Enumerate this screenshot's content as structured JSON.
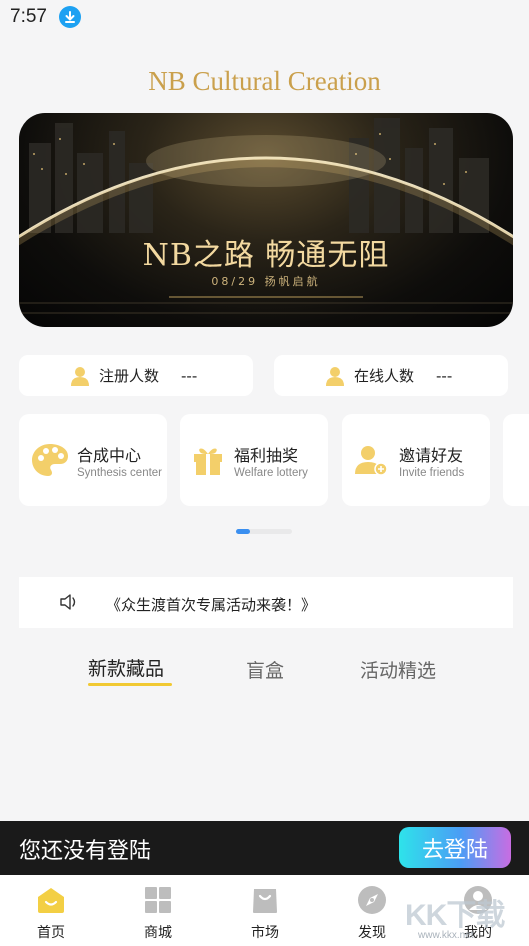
{
  "status_bar": {
    "time": "7:57",
    "download_icon": "download-icon"
  },
  "app": {
    "title": "NB Cultural Creation"
  },
  "banner": {
    "title": "NB之路  畅通无阻",
    "subtitle": "08/29   扬帆启航"
  },
  "stats": [
    {
      "label": "注册人数",
      "value": "---",
      "icon": "person-icon"
    },
    {
      "label": "在线人数",
      "value": "---",
      "icon": "person-icon"
    }
  ],
  "features": [
    {
      "title": "合成中心",
      "subtitle": "Synthesis center",
      "icon": "palette-icon"
    },
    {
      "title": "福利抽奖",
      "subtitle": "Welfare lottery",
      "icon": "gift-icon"
    },
    {
      "title": "邀请好友",
      "subtitle": "Invite friends",
      "icon": "add-user-icon"
    }
  ],
  "notice": {
    "text": "《众生渡首次专属活动来袭！》",
    "icon": "speaker-icon"
  },
  "tabs": [
    {
      "label": "新款藏品",
      "active": true
    },
    {
      "label": "盲盒",
      "active": false
    },
    {
      "label": "活动精选",
      "active": false
    }
  ],
  "login": {
    "prompt": "您还没有登陆",
    "button": "去登陆"
  },
  "bottom_nav": [
    {
      "label": "首页",
      "icon": "home-icon",
      "active": true
    },
    {
      "label": "商城",
      "icon": "grid-icon"
    },
    {
      "label": "市场",
      "icon": "bag-icon"
    },
    {
      "label": "发现",
      "icon": "compass-icon"
    },
    {
      "label": "我的",
      "icon": "user-icon"
    }
  ],
  "watermark": {
    "text": "KK下载",
    "url": "www.kkx.net"
  },
  "colors": {
    "accent": "#f1c932",
    "title_gold": "#caa04c",
    "login_bar": "#1a1a1a",
    "pager_active": "#3a8ff0"
  }
}
